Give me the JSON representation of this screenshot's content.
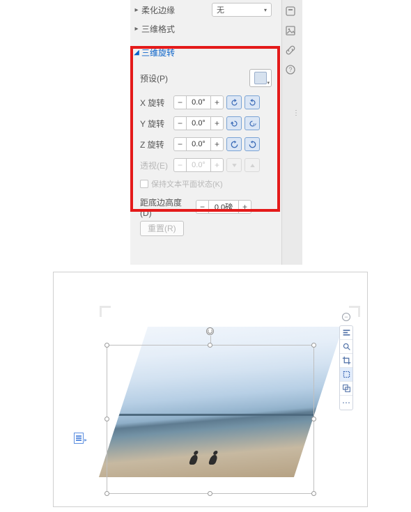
{
  "panel": {
    "soften_edges": {
      "label": "柔化边缘",
      "value": "无"
    },
    "format_3d": {
      "label": "三维格式"
    },
    "rotation_3d": {
      "label": "三维旋转",
      "preset_label": "预设(P)",
      "x_label": "X 旋转",
      "y_label": "Y 旋转",
      "z_label": "Z 旋转",
      "perspective_label": "透视(E)",
      "x_value": "0.0°",
      "y_value": "0.0°",
      "z_value": "0.0°",
      "perspective_value": "0.0°",
      "keep_text_flat": "保持文本平面状态(K)"
    },
    "distance_label": "距底边高度(D)",
    "distance_value": "0.0磅",
    "reset_label": "重置(R)"
  },
  "symbols": {
    "minus": "−",
    "plus": "+",
    "caret_down": "▾",
    "tri_right": "▸",
    "tri_down": "◢"
  }
}
